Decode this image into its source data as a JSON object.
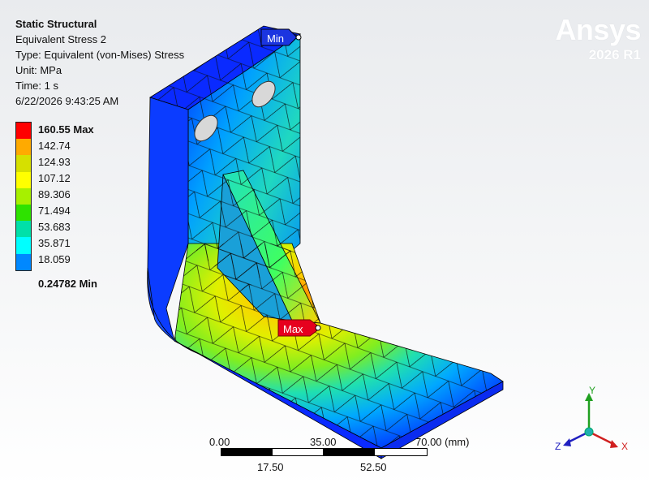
{
  "info": {
    "title": "Static Structural",
    "result": "Equivalent Stress 2",
    "type": "Type: Equivalent (von-Mises) Stress",
    "unit": "Unit: MPa",
    "time": "Time: 1 s",
    "date": "6/22/2026 9:43:25 AM"
  },
  "brand": {
    "name": "Ansys",
    "version": "2026 R1"
  },
  "legend": {
    "max_label": "160.55 Max",
    "labels": [
      "142.74",
      "124.93",
      "107.12",
      "89.306",
      "71.494",
      "53.683",
      "35.871",
      "18.059"
    ],
    "min_label": "0.24782 Min",
    "colors": [
      "#ff0000",
      "#ffaa00",
      "#d6e000",
      "#ffff00",
      "#a7f000",
      "#2ee200",
      "#00e0a8",
      "#00ffff",
      "#0088ff",
      "#0000ff"
    ]
  },
  "probes": {
    "max_label": "Max",
    "min_label": "Min",
    "max_color": "#e6001e",
    "min_color": "#1b35e0"
  },
  "scale": {
    "ticks_top": [
      "0.00",
      "35.00",
      "70.00 (mm)"
    ],
    "ticks_bottom": [
      "17.50",
      "52.50"
    ]
  },
  "triad": {
    "x": "X",
    "y": "Y",
    "z": "Z",
    "x_color": "#d02020",
    "y_color": "#20a020",
    "z_color": "#2020c0"
  }
}
